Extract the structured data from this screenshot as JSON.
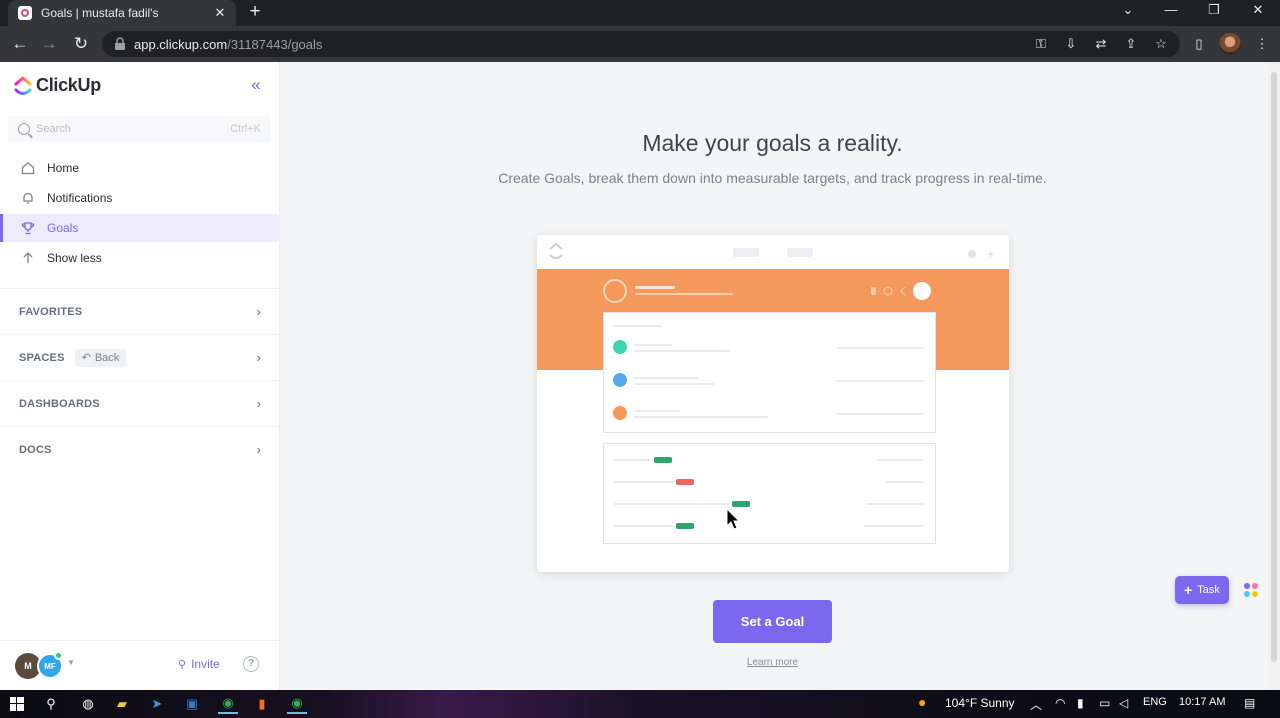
{
  "browser": {
    "tab_title": "Goals | mustafa fadil's",
    "tab_close": "✕",
    "new_tab": "+",
    "url_domain": "app.clickup.com",
    "url_path": "/31187443/goals"
  },
  "sidebar": {
    "logo_text": "ClickUp",
    "search_placeholder": "Search",
    "search_shortcut": "Ctrl+K",
    "nav": [
      {
        "label": "Home",
        "icon": "home-icon"
      },
      {
        "label": "Notifications",
        "icon": "bell-icon"
      },
      {
        "label": "Goals",
        "icon": "trophy-icon",
        "active": true
      },
      {
        "label": "Show less",
        "icon": "arrow-up-icon"
      }
    ],
    "sections": [
      {
        "label": "FAVORITES"
      },
      {
        "label": "SPACES",
        "chip": "Back"
      },
      {
        "label": "DASHBOARDS"
      },
      {
        "label": "DOCS"
      }
    ],
    "footer": {
      "avatar_initial": "M",
      "avatar_initials_2": "MF",
      "invite_label": "Invite",
      "help_label": "?"
    }
  },
  "main": {
    "title": "Make your goals a reality.",
    "subtitle": "Create Goals, break them down into measurable targets, and track progress in real-time.",
    "cta_label": "Set a Goal",
    "learn_more": "Learn more",
    "task_button": "Task"
  },
  "colors": {
    "accent": "#7b68ee",
    "banner_orange": "#f5985c",
    "green": "#2ea56a",
    "red": "#e8685f",
    "teal": "#3fd4b1",
    "blue": "#5aa8f0",
    "orange": "#f5985c"
  },
  "taskbar": {
    "weather": "104°F  Sunny",
    "language": "ENG",
    "time": "10:17 AM"
  }
}
